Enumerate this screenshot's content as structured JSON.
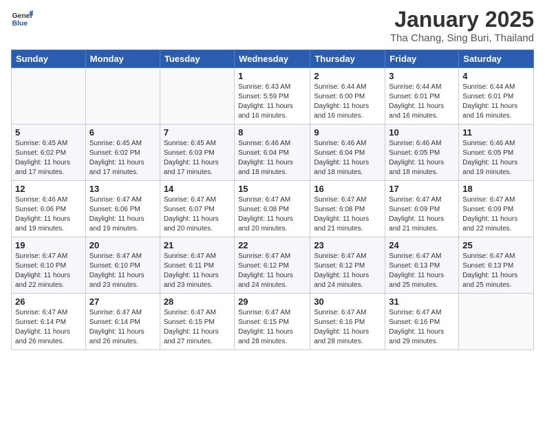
{
  "logo": {
    "general": "General",
    "blue": "Blue"
  },
  "title": {
    "month": "January 2025",
    "location": "Tha Chang, Sing Buri, Thailand"
  },
  "weekdays": [
    "Sunday",
    "Monday",
    "Tuesday",
    "Wednesday",
    "Thursday",
    "Friday",
    "Saturday"
  ],
  "weeks": [
    [
      {
        "day": "",
        "sunrise": "",
        "sunset": "",
        "daylight": ""
      },
      {
        "day": "",
        "sunrise": "",
        "sunset": "",
        "daylight": ""
      },
      {
        "day": "",
        "sunrise": "",
        "sunset": "",
        "daylight": ""
      },
      {
        "day": "1",
        "sunrise": "Sunrise: 6:43 AM",
        "sunset": "Sunset: 5:59 PM",
        "daylight": "Daylight: 11 hours and 16 minutes."
      },
      {
        "day": "2",
        "sunrise": "Sunrise: 6:44 AM",
        "sunset": "Sunset: 6:00 PM",
        "daylight": "Daylight: 11 hours and 16 minutes."
      },
      {
        "day": "3",
        "sunrise": "Sunrise: 6:44 AM",
        "sunset": "Sunset: 6:01 PM",
        "daylight": "Daylight: 11 hours and 16 minutes."
      },
      {
        "day": "4",
        "sunrise": "Sunrise: 6:44 AM",
        "sunset": "Sunset: 6:01 PM",
        "daylight": "Daylight: 11 hours and 16 minutes."
      }
    ],
    [
      {
        "day": "5",
        "sunrise": "Sunrise: 6:45 AM",
        "sunset": "Sunset: 6:02 PM",
        "daylight": "Daylight: 11 hours and 17 minutes."
      },
      {
        "day": "6",
        "sunrise": "Sunrise: 6:45 AM",
        "sunset": "Sunset: 6:02 PM",
        "daylight": "Daylight: 11 hours and 17 minutes."
      },
      {
        "day": "7",
        "sunrise": "Sunrise: 6:45 AM",
        "sunset": "Sunset: 6:03 PM",
        "daylight": "Daylight: 11 hours and 17 minutes."
      },
      {
        "day": "8",
        "sunrise": "Sunrise: 6:46 AM",
        "sunset": "Sunset: 6:04 PM",
        "daylight": "Daylight: 11 hours and 18 minutes."
      },
      {
        "day": "9",
        "sunrise": "Sunrise: 6:46 AM",
        "sunset": "Sunset: 6:04 PM",
        "daylight": "Daylight: 11 hours and 18 minutes."
      },
      {
        "day": "10",
        "sunrise": "Sunrise: 6:46 AM",
        "sunset": "Sunset: 6:05 PM",
        "daylight": "Daylight: 11 hours and 18 minutes."
      },
      {
        "day": "11",
        "sunrise": "Sunrise: 6:46 AM",
        "sunset": "Sunset: 6:05 PM",
        "daylight": "Daylight: 11 hours and 19 minutes."
      }
    ],
    [
      {
        "day": "12",
        "sunrise": "Sunrise: 6:46 AM",
        "sunset": "Sunset: 6:06 PM",
        "daylight": "Daylight: 11 hours and 19 minutes."
      },
      {
        "day": "13",
        "sunrise": "Sunrise: 6:47 AM",
        "sunset": "Sunset: 6:06 PM",
        "daylight": "Daylight: 11 hours and 19 minutes."
      },
      {
        "day": "14",
        "sunrise": "Sunrise: 6:47 AM",
        "sunset": "Sunset: 6:07 PM",
        "daylight": "Daylight: 11 hours and 20 minutes."
      },
      {
        "day": "15",
        "sunrise": "Sunrise: 6:47 AM",
        "sunset": "Sunset: 6:08 PM",
        "daylight": "Daylight: 11 hours and 20 minutes."
      },
      {
        "day": "16",
        "sunrise": "Sunrise: 6:47 AM",
        "sunset": "Sunset: 6:08 PM",
        "daylight": "Daylight: 11 hours and 21 minutes."
      },
      {
        "day": "17",
        "sunrise": "Sunrise: 6:47 AM",
        "sunset": "Sunset: 6:09 PM",
        "daylight": "Daylight: 11 hours and 21 minutes."
      },
      {
        "day": "18",
        "sunrise": "Sunrise: 6:47 AM",
        "sunset": "Sunset: 6:09 PM",
        "daylight": "Daylight: 11 hours and 22 minutes."
      }
    ],
    [
      {
        "day": "19",
        "sunrise": "Sunrise: 6:47 AM",
        "sunset": "Sunset: 6:10 PM",
        "daylight": "Daylight: 11 hours and 22 minutes."
      },
      {
        "day": "20",
        "sunrise": "Sunrise: 6:47 AM",
        "sunset": "Sunset: 6:10 PM",
        "daylight": "Daylight: 11 hours and 23 minutes."
      },
      {
        "day": "21",
        "sunrise": "Sunrise: 6:47 AM",
        "sunset": "Sunset: 6:11 PM",
        "daylight": "Daylight: 11 hours and 23 minutes."
      },
      {
        "day": "22",
        "sunrise": "Sunrise: 6:47 AM",
        "sunset": "Sunset: 6:12 PM",
        "daylight": "Daylight: 11 hours and 24 minutes."
      },
      {
        "day": "23",
        "sunrise": "Sunrise: 6:47 AM",
        "sunset": "Sunset: 6:12 PM",
        "daylight": "Daylight: 11 hours and 24 minutes."
      },
      {
        "day": "24",
        "sunrise": "Sunrise: 6:47 AM",
        "sunset": "Sunset: 6:13 PM",
        "daylight": "Daylight: 11 hours and 25 minutes."
      },
      {
        "day": "25",
        "sunrise": "Sunrise: 6:47 AM",
        "sunset": "Sunset: 6:13 PM",
        "daylight": "Daylight: 11 hours and 25 minutes."
      }
    ],
    [
      {
        "day": "26",
        "sunrise": "Sunrise: 6:47 AM",
        "sunset": "Sunset: 6:14 PM",
        "daylight": "Daylight: 11 hours and 26 minutes."
      },
      {
        "day": "27",
        "sunrise": "Sunrise: 6:47 AM",
        "sunset": "Sunset: 6:14 PM",
        "daylight": "Daylight: 11 hours and 26 minutes."
      },
      {
        "day": "28",
        "sunrise": "Sunrise: 6:47 AM",
        "sunset": "Sunset: 6:15 PM",
        "daylight": "Daylight: 11 hours and 27 minutes."
      },
      {
        "day": "29",
        "sunrise": "Sunrise: 6:47 AM",
        "sunset": "Sunset: 6:15 PM",
        "daylight": "Daylight: 11 hours and 28 minutes."
      },
      {
        "day": "30",
        "sunrise": "Sunrise: 6:47 AM",
        "sunset": "Sunset: 6:16 PM",
        "daylight": "Daylight: 11 hours and 28 minutes."
      },
      {
        "day": "31",
        "sunrise": "Sunrise: 6:47 AM",
        "sunset": "Sunset: 6:16 PM",
        "daylight": "Daylight: 11 hours and 29 minutes."
      },
      {
        "day": "",
        "sunrise": "",
        "sunset": "",
        "daylight": ""
      }
    ]
  ]
}
